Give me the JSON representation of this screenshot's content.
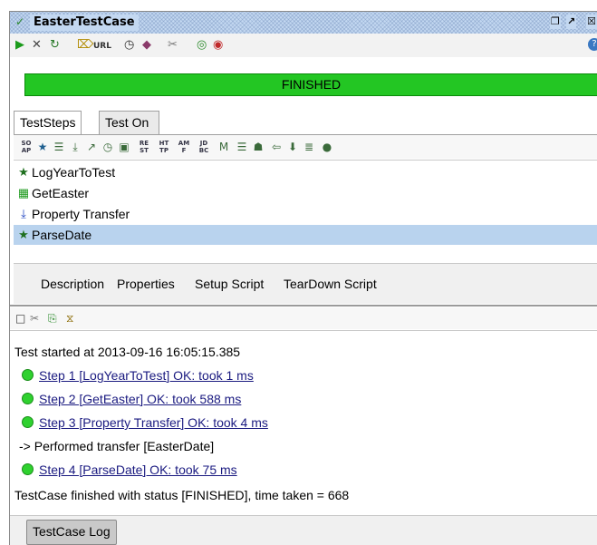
{
  "window": {
    "title": "EasterTestCase",
    "restore_glyph": "❐",
    "maximize_glyph": "↗",
    "close_glyph": "☒"
  },
  "toolbar": {
    "run_icon": "▶",
    "cancel_icon": "✕",
    "loop_icon": "↻",
    "credentials_icon": "⌦",
    "url_label": "URL",
    "timer_icon": "◷",
    "security_icon": "◆",
    "options_icon": "✂",
    "loadtest_icon": "◎",
    "securitytest_icon": "◉",
    "help_icon": "?"
  },
  "status": {
    "text": "FINISHED",
    "color": "#23c623"
  },
  "tabs": [
    {
      "label": "TestSteps"
    },
    {
      "label": "Test On Demand"
    }
  ],
  "step_toolbar": [
    {
      "icon": "soap-request-icon",
      "glyph": "SO AP"
    },
    {
      "icon": "groovy-star-icon",
      "glyph": "★"
    },
    {
      "icon": "properties-icon",
      "glyph": "☰"
    },
    {
      "icon": "transfer-icon",
      "glyph": "⤓"
    },
    {
      "icon": "conditional-goto-icon",
      "glyph": "↗"
    },
    {
      "icon": "delay-icon",
      "glyph": "◷"
    },
    {
      "icon": "run-testcase-icon",
      "glyph": "▣"
    },
    {
      "icon": "rest-request-icon",
      "glyph": "RE ST"
    },
    {
      "icon": "http-request-icon",
      "glyph": "HT TP"
    },
    {
      "icon": "amf-request-icon",
      "glyph": "AM F"
    },
    {
      "icon": "jdbc-request-icon",
      "glyph": "JD BC"
    },
    {
      "icon": "mockresponse-icon",
      "glyph": "M"
    },
    {
      "icon": "manual-step-icon",
      "glyph": "☰"
    },
    {
      "icon": "assertion-icon",
      "glyph": "☗"
    },
    {
      "icon": "arrow-left-icon",
      "glyph": "⇦"
    },
    {
      "icon": "move-down-icon",
      "glyph": "⬇"
    },
    {
      "icon": "list-icon",
      "glyph": "≣"
    },
    {
      "icon": "circle-icon",
      "glyph": "●"
    }
  ],
  "steps": [
    {
      "label": "LogYearToTest",
      "glyph": "★",
      "color": "#1f6f1f"
    },
    {
      "label": "GetEaster",
      "glyph": "▦",
      "color": "#1e9a1e"
    },
    {
      "label": "Property Transfer",
      "glyph": "⤓",
      "color": "#1a3fbf"
    },
    {
      "label": "ParseDate",
      "glyph": "★",
      "color": "#1f6f1f"
    }
  ],
  "desc_tabs": [
    "Description",
    "Properties",
    "Setup Script",
    "TearDown Script"
  ],
  "log_toolbar": {
    "clear_icon": "□",
    "options_icon": "✂",
    "export_icon": "⎘",
    "filter_icon": "⧖"
  },
  "log": {
    "header": "Test started at 2013-09-16 16:05:15.385",
    "lines": [
      "Step 1 [LogYearToTest] OK: took 1 ms",
      "Step 2 [GetEaster] OK: took 588 ms",
      "Step 3 [Property Transfer] OK: took 4 ms",
      "-> Performed transfer [EasterDate]",
      "Step 4 [ParseDate] OK: took 75 ms"
    ],
    "footer": "TestCase finished with status [FINISHED], time taken = 668"
  },
  "bottom_tab": "TestCase Log"
}
